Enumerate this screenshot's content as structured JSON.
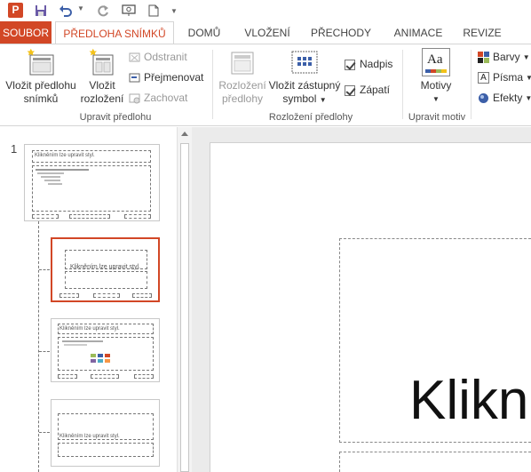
{
  "quick_access": {
    "app_logo": "P",
    "icons": [
      "powerpoint-logo",
      "save-icon",
      "undo-icon",
      "redo-icon",
      "start-slideshow-icon",
      "new-file-icon",
      "customize-icon"
    ]
  },
  "tabs": {
    "file": "SOUBOR",
    "slide_master": "PŘEDLOHA SNÍMKŮ",
    "home": "DOMŮ",
    "insert": "VLOŽENÍ",
    "transitions": "PŘECHODY",
    "animations": "ANIMACE",
    "review": "REVIZE"
  },
  "ribbon": {
    "edit_master": {
      "label": "Upravit předlohu",
      "insert_master_line1": "Vložit předlohu",
      "insert_master_line2": "snímků",
      "insert_layout_line1": "Vložit",
      "insert_layout_line2": "rozložení",
      "delete": "Odstranit",
      "rename": "Přejmenovat",
      "preserve": "Zachovat"
    },
    "master_layout": {
      "label": "Rozložení předlohy",
      "layout_line1": "Rozložení",
      "layout_line2": "předlohy",
      "placeholder_line1": "Vložit zástupný",
      "placeholder_line2": "symbol",
      "title_checkbox": "Nadpis",
      "footers_checkbox": "Zápatí"
    },
    "edit_theme": {
      "label": "Upravit motiv",
      "themes": "Motivy",
      "themes_icon_text": "Aa"
    },
    "background": {
      "colors": "Barvy",
      "fonts": "Písma",
      "effects": "Efekty",
      "fonts_icon_text": "A"
    }
  },
  "thumbnails": {
    "slide_number": "1",
    "master_title": "Klikněním lze upravit styl.",
    "layout1_title": "Klikněním lze upravit styl.",
    "layout2_title": "Klikněním lze upravit styl.",
    "layout3_title": "Klikněním lze upravit styl."
  },
  "slide": {
    "title_text": "Klikn"
  },
  "colors": {
    "accent": "#d24726",
    "ribbon_bg": "#ffffff",
    "pane_bg": "#ebebeb"
  }
}
